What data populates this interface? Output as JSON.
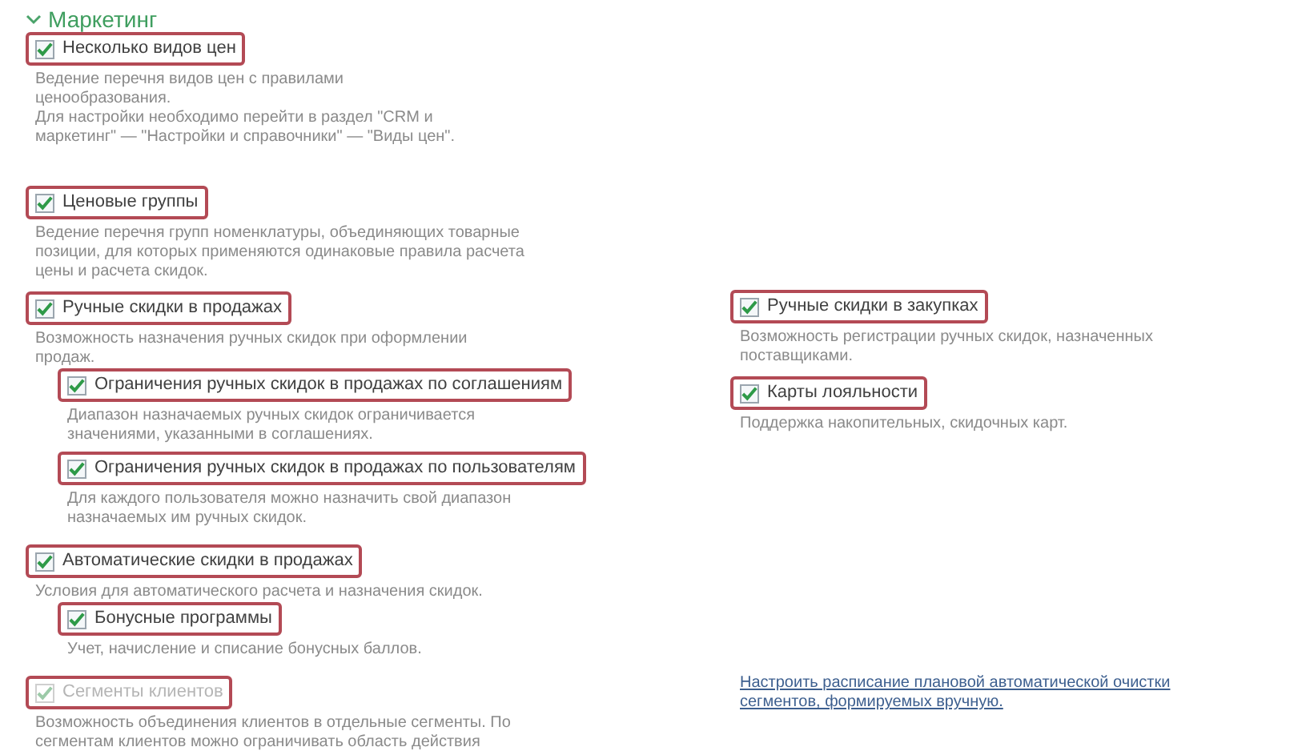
{
  "section": {
    "title": "Маркетинг",
    "expanded": true
  },
  "left": [
    {
      "label": "Несколько видов цен",
      "checked": true,
      "disabled": false,
      "highlighted": true,
      "description": "Ведение перечня видов цен с правилами\nценообразования.\nДля настройки необходимо перейти в раздел \"CRM и\nмаркетинг\" — \"Настройки и справочники\" — \"Виды цен\"."
    },
    {
      "label": "Ценовые группы",
      "checked": true,
      "disabled": false,
      "highlighted": true,
      "description": "Ведение перечня групп номенклатуры, объединяющих товарные\nпозиции, для которых применяются одинаковые правила расчета\nцены и расчета скидок."
    },
    {
      "label": "Ручные скидки в продажах",
      "checked": true,
      "disabled": false,
      "highlighted": true,
      "description": "Возможность назначения ручных скидок при оформлении\nпродаж.",
      "children": [
        {
          "label": "Ограничения ручных скидок в продажах по соглашениям",
          "checked": true,
          "disabled": false,
          "highlighted": true,
          "description": "Диапазон назначаемых ручных скидок ограничивается\nзначениями, указанными в соглашениях."
        },
        {
          "label": "Ограничения ручных скидок в продажах по пользователям",
          "checked": true,
          "disabled": false,
          "highlighted": true,
          "description": "Для каждого пользователя можно назначить свой диапазон\nназначаемых им ручных скидок."
        }
      ]
    },
    {
      "label": "Автоматические скидки в продажах",
      "checked": true,
      "disabled": false,
      "highlighted": true,
      "description": "Условия для автоматического расчета и назначения скидок.",
      "children": [
        {
          "label": "Бонусные программы",
          "checked": true,
          "disabled": false,
          "highlighted": true,
          "description": "Учет, начисление и списание бонусных баллов."
        }
      ]
    },
    {
      "label": "Сегменты клиентов",
      "checked": true,
      "disabled": true,
      "highlighted": true,
      "description": "Возможность объединения клиентов в отдельные сегменты. По\nсегментам клиентов можно ограничивать область действия"
    }
  ],
  "right": [
    {
      "kind": "checkbox",
      "label": "Ручные скидки в закупках",
      "checked": true,
      "disabled": false,
      "highlighted": true,
      "description": "Возможность регистрации ручных скидок, назначенных\nпоставщиками."
    },
    {
      "kind": "checkbox",
      "label": "Карты лояльности",
      "checked": true,
      "disabled": false,
      "highlighted": true,
      "description": "Поддержка накопительных, скидочных карт."
    },
    {
      "kind": "link",
      "label": "Настроить расписание плановой автоматической очистки\nсегментов, формируемых вручную."
    }
  ]
}
